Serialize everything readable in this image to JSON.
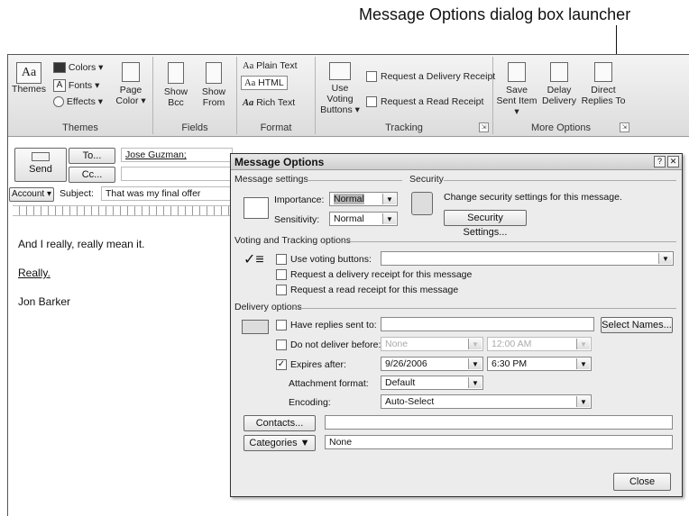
{
  "callout": "Message Options dialog box launcher",
  "ribbon": {
    "themes": {
      "themes_label": "Themes",
      "colors": "Colors ▾",
      "fonts": "Fonts ▾",
      "effects": "Effects ▾",
      "page_color": "Page Color ▾",
      "group": "Themes"
    },
    "fields": {
      "show_bcc": "Show Bcc",
      "show_from": "Show From",
      "group": "Fields"
    },
    "format": {
      "plain": "Plain Text",
      "html": "HTML",
      "rich": "Rich Text",
      "group": "Format"
    },
    "tracking": {
      "voting": "Use Voting Buttons ▾",
      "delivery": "Request a Delivery Receipt",
      "read": "Request a Read Receipt",
      "group": "Tracking"
    },
    "more": {
      "save_sent": "Save Sent Item ▾",
      "delay": "Delay Delivery",
      "direct": "Direct Replies To",
      "group": "More Options"
    }
  },
  "compose": {
    "send": "Send",
    "to": "To...",
    "cc": "Cc...",
    "account": "Account ▾",
    "subject_label": "Subject:",
    "to_value": "Jose Guzman;",
    "subject_value": "That was my final offer",
    "body": [
      "And I really, really mean it.",
      "Really.",
      "Jon Barker"
    ]
  },
  "dialog": {
    "title": "Message Options",
    "message_settings": "Message settings",
    "security": "Security",
    "importance_label": "Importance:",
    "importance_value": "Normal",
    "sensitivity_label": "Sensitivity:",
    "sensitivity_value": "Normal",
    "security_text": "Change security settings for this message.",
    "security_button": "Security Settings...",
    "voting_section": "Voting and Tracking options",
    "use_voting": "Use voting buttons:",
    "req_delivery": "Request a delivery receipt for this message",
    "req_read": "Request a read receipt for this message",
    "delivery_section": "Delivery options",
    "have_replies": "Have replies sent to:",
    "select_names": "Select Names...",
    "do_not_deliver": "Do not deliver before:",
    "dnd_date": "None",
    "dnd_time": "12:00 AM",
    "expires_after": "Expires after:",
    "exp_date": "9/26/2006",
    "exp_time": "6:30 PM",
    "attachment_label": "Attachment format:",
    "attachment_value": "Default",
    "encoding_label": "Encoding:",
    "encoding_value": "Auto-Select",
    "contacts": "Contacts...",
    "categories": "Categories ▼",
    "categories_value": "None",
    "close": "Close"
  }
}
